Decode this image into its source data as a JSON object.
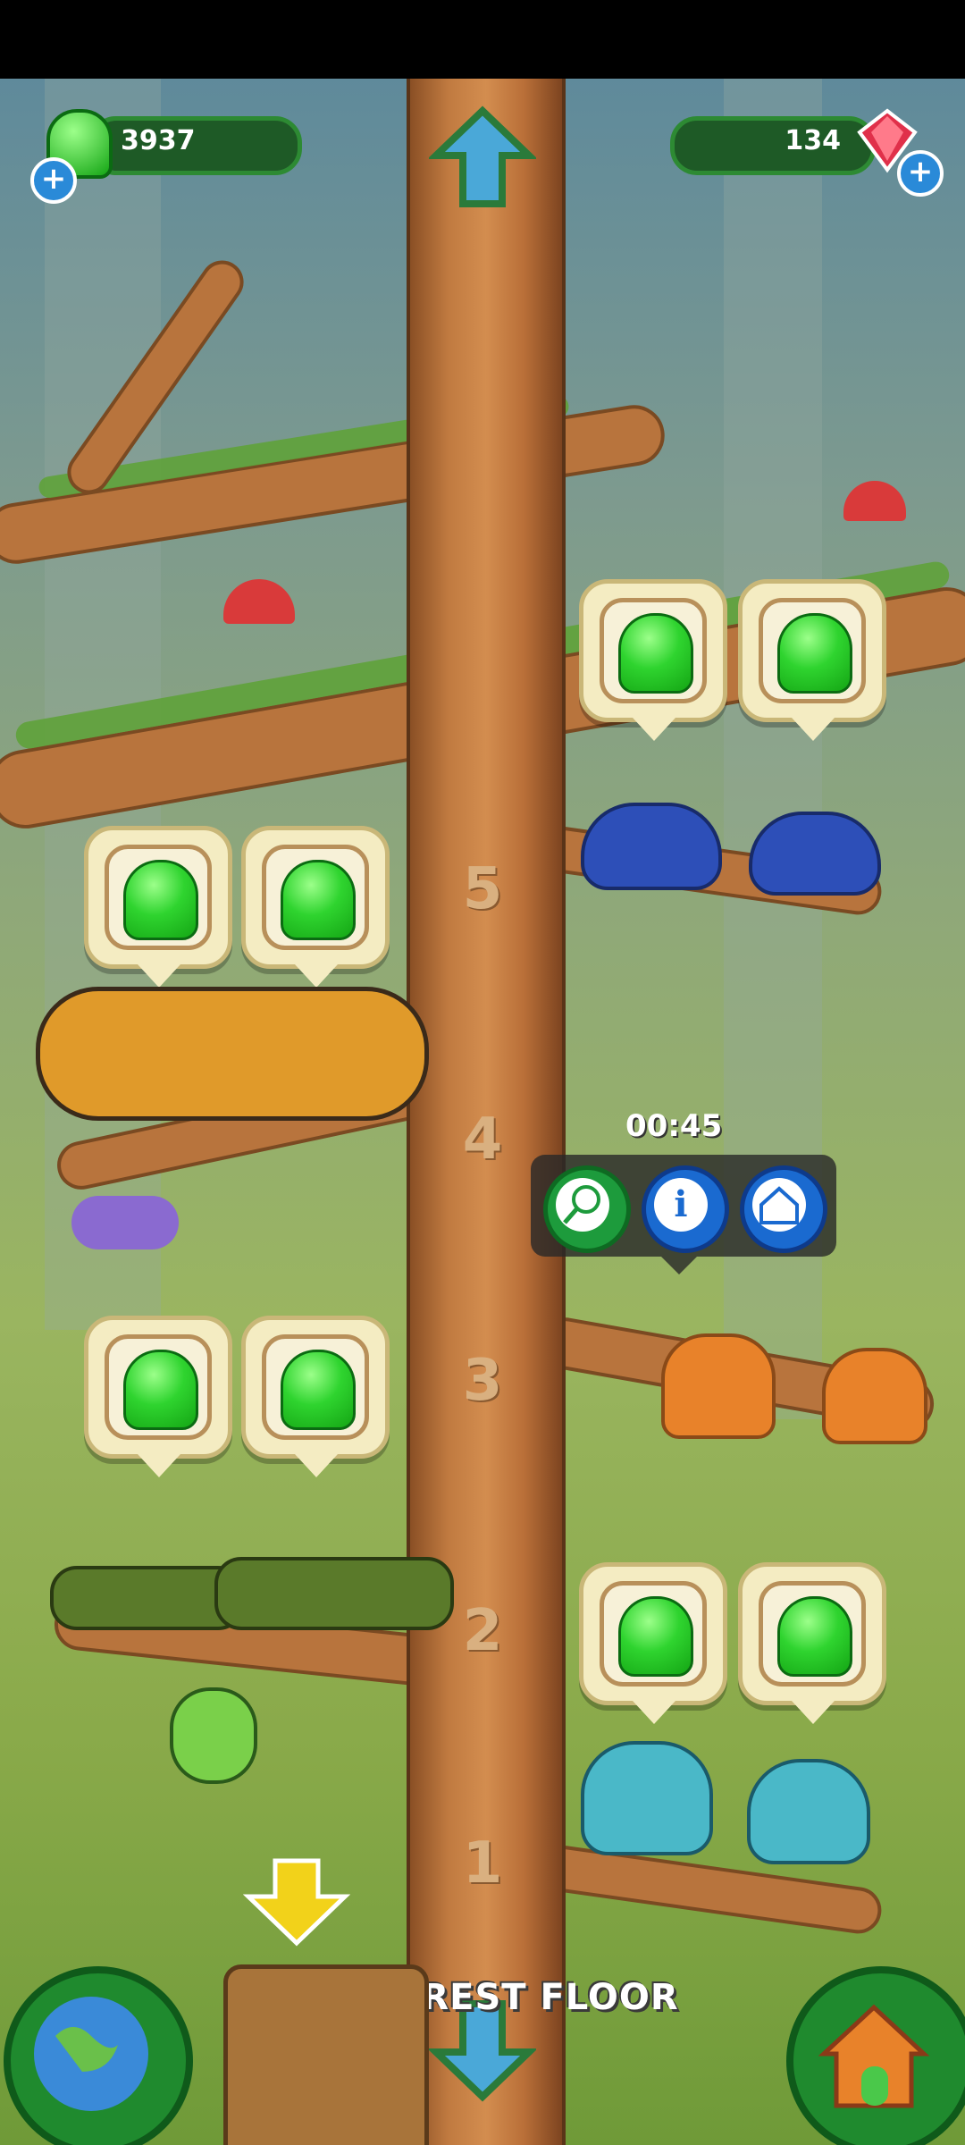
{
  "hud": {
    "jelly_count": "3937",
    "gem_count": "134"
  },
  "floors": [
    "5",
    "4",
    "3",
    "2",
    "1"
  ],
  "timer": "00:45",
  "floor_label": "FOREST FLOOR",
  "icons": {
    "jelly": "green-jelly-icon",
    "gem": "red-gem-icon",
    "add": "plus-icon",
    "up": "up-arrow-icon",
    "down": "down-arrow-icon",
    "net": "net-icon",
    "info": "info-icon",
    "home": "house-icon",
    "globe": "globe-icon",
    "yellow_arrow": "yellow-down-arrow-icon"
  },
  "colors": {
    "jelly_green": "#2fd42f",
    "hud_bg": "#1e5a26",
    "trunk": "#c07a40",
    "gem": "#e0304a"
  }
}
